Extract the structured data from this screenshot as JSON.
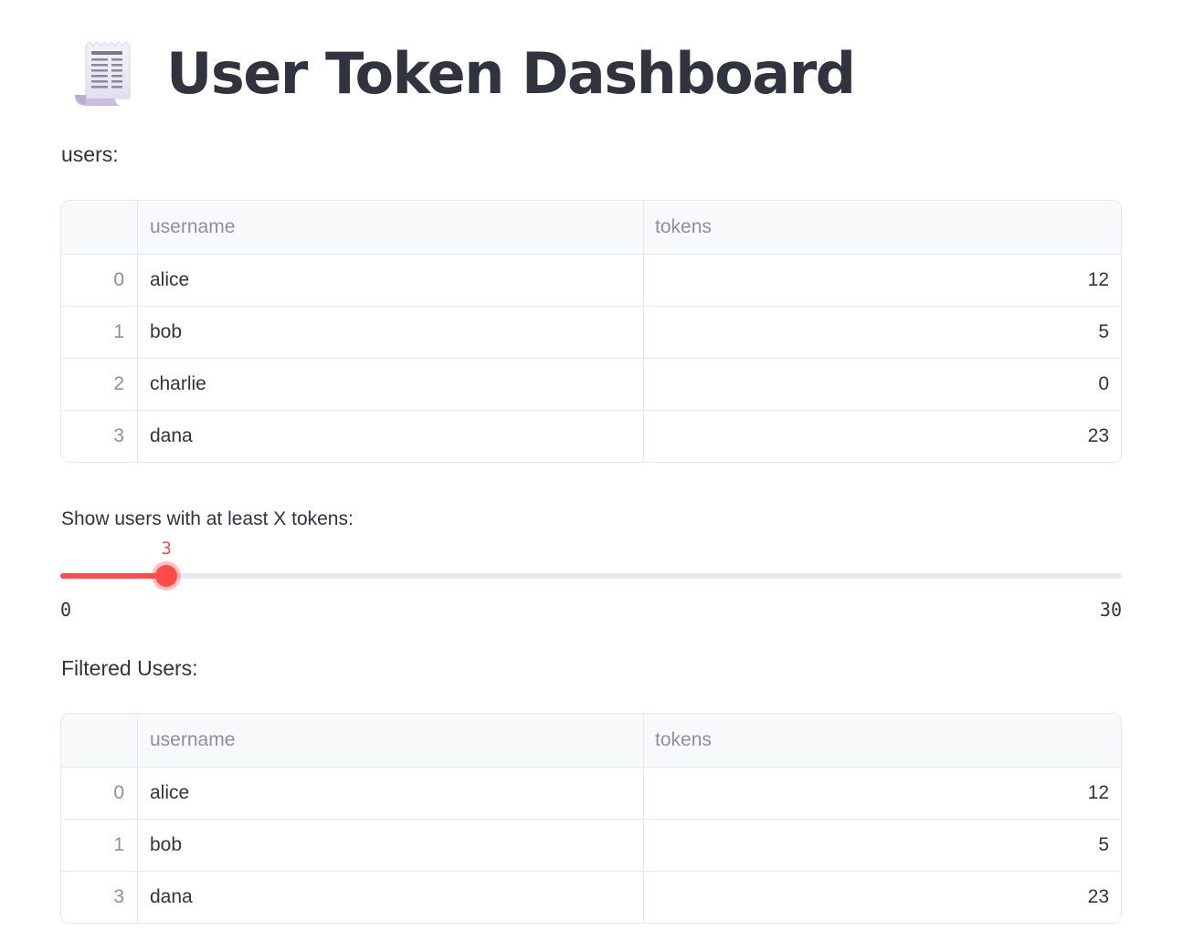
{
  "header": {
    "icon": "receipt-icon",
    "title": "User Token Dashboard"
  },
  "users_section": {
    "label": "users:",
    "columns": {
      "index": "",
      "username": "username",
      "tokens": "tokens"
    },
    "rows": [
      {
        "index": "0",
        "username": "alice",
        "tokens": "12"
      },
      {
        "index": "1",
        "username": "bob",
        "tokens": "5"
      },
      {
        "index": "2",
        "username": "charlie",
        "tokens": "0"
      },
      {
        "index": "3",
        "username": "dana",
        "tokens": "23"
      }
    ]
  },
  "slider": {
    "label": "Show users with at least X tokens:",
    "value": 3,
    "value_label": "3",
    "min": 0,
    "max": 30,
    "min_label": "0",
    "max_label": "30",
    "accent_color": "#ff4b4b"
  },
  "filtered_section": {
    "label": "Filtered Users:",
    "columns": {
      "index": "",
      "username": "username",
      "tokens": "tokens"
    },
    "rows": [
      {
        "index": "0",
        "username": "alice",
        "tokens": "12"
      },
      {
        "index": "1",
        "username": "bob",
        "tokens": "5"
      },
      {
        "index": "3",
        "username": "dana",
        "tokens": "23"
      }
    ]
  }
}
